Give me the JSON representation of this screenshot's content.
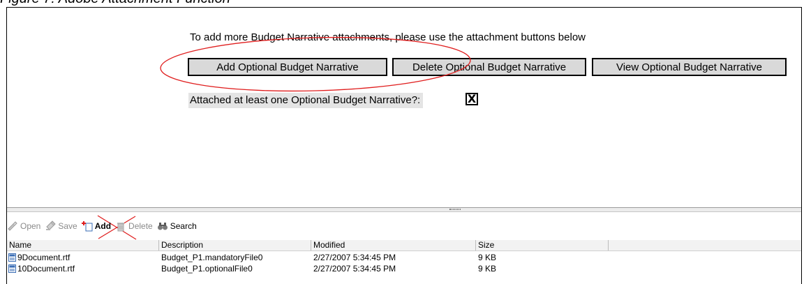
{
  "figure_caption": "Figure 7: Adobe Attachment Function",
  "form": {
    "instruction": "To add more Budget Narrative attachments, please use the attachment buttons below",
    "buttons": {
      "add": "Add Optional Budget Narrative",
      "delete": "Delete Optional Budget Narrative",
      "view": "View Optional Budget Narrative"
    },
    "attached_label": "Attached at least one Optional Budget Narrative?:",
    "attached_checked_mark": "X"
  },
  "annotation_color": "#e01e1e",
  "toolbar": {
    "open": "Open",
    "save": "Save",
    "add": "Add",
    "delete": "Delete",
    "search": "Search"
  },
  "table": {
    "columns": [
      "Name",
      "Description",
      "Modified",
      "Size"
    ],
    "rows": [
      {
        "name": "9Document.rtf",
        "description": "Budget_P1.mandatoryFile0",
        "modified": "2/27/2007 5:34:45 PM",
        "size": "9 KB"
      },
      {
        "name": "10Document.rtf",
        "description": "Budget_P1.optionalFile0",
        "modified": "2/27/2007 5:34:45 PM",
        "size": "9 KB"
      }
    ]
  }
}
